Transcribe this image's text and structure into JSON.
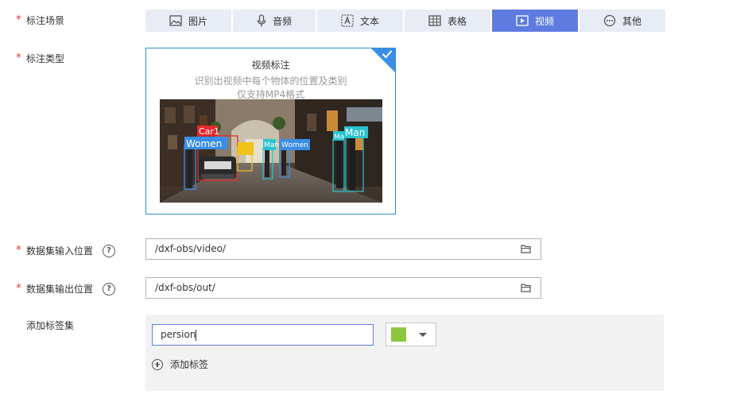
{
  "scene": {
    "label": "标注场景",
    "tabs": [
      {
        "label": "图片",
        "icon": "image-icon",
        "active": false
      },
      {
        "label": "音频",
        "icon": "microphone-icon",
        "active": false
      },
      {
        "label": "文本",
        "icon": "text-icon",
        "active": false
      },
      {
        "label": "表格",
        "icon": "table-icon",
        "active": false
      },
      {
        "label": "视频",
        "icon": "video-icon",
        "active": true
      },
      {
        "label": "其他",
        "icon": "more-icon",
        "active": false
      }
    ]
  },
  "type": {
    "label": "标注类型",
    "card_title": "视频标注",
    "card_desc1": "识别出视频中每个物体的位置及类别",
    "card_desc2": "仅支持MP4格式",
    "preview_labels": [
      "Car1",
      "Women",
      "Man",
      "Women",
      "Ma",
      "Man"
    ]
  },
  "input_location": {
    "label": "数据集输入位置",
    "value": "/dxf-obs/video/"
  },
  "output_location": {
    "label": "数据集输出位置",
    "value": "/dxf-obs/out/"
  },
  "tagset": {
    "label": "添加标签集",
    "tag_value": "persion",
    "tag_color": "#8dc63f",
    "add_tag_label": "添加标签"
  },
  "colors": {
    "accent": "#5e7ce0",
    "required": "#e84040",
    "selected_border": "#2f8ecf"
  }
}
